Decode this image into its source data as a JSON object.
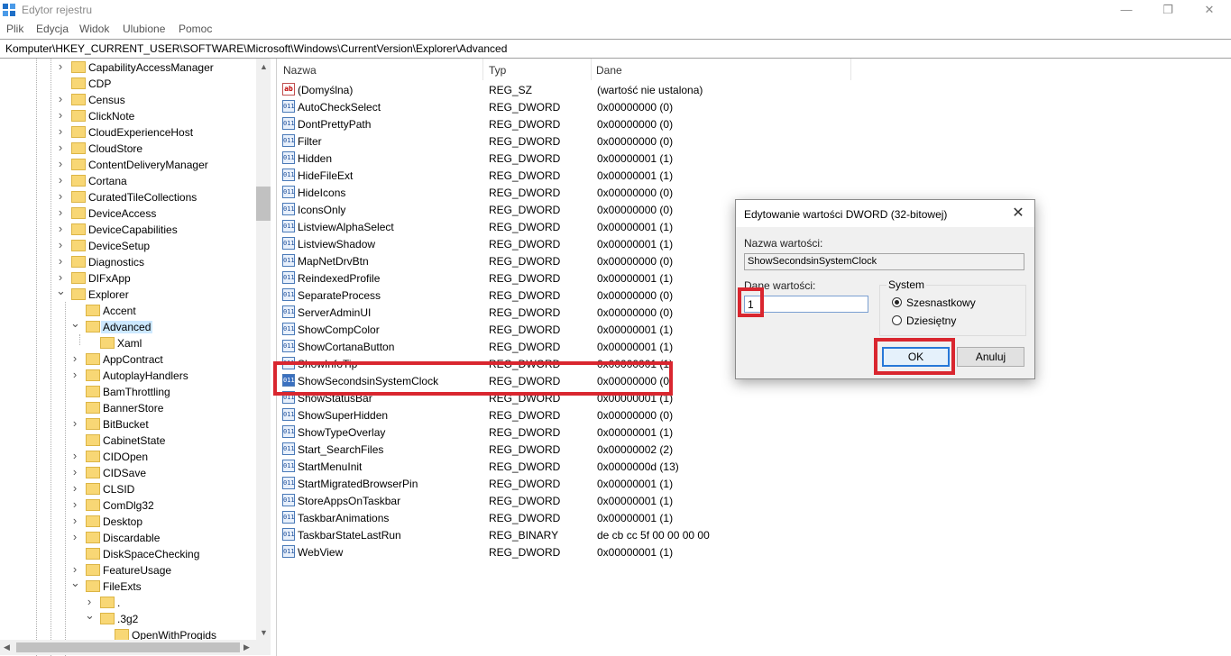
{
  "window": {
    "title": "Edytor rejestru",
    "minimize": "—",
    "restore": "❐",
    "close": "✕"
  },
  "menu": [
    "Plik",
    "Edycja",
    "Widok",
    "Ulubione",
    "Pomoc"
  ],
  "address": "Komputer\\HKEY_CURRENT_USER\\SOFTWARE\\Microsoft\\Windows\\CurrentVersion\\Explorer\\Advanced",
  "tree": [
    {
      "label": "CapabilityAccessManager",
      "level": 0,
      "expander": "collapsed"
    },
    {
      "label": "CDP",
      "level": 0,
      "expander": "none"
    },
    {
      "label": "Census",
      "level": 0,
      "expander": "collapsed"
    },
    {
      "label": "ClickNote",
      "level": 0,
      "expander": "collapsed"
    },
    {
      "label": "CloudExperienceHost",
      "level": 0,
      "expander": "collapsed"
    },
    {
      "label": "CloudStore",
      "level": 0,
      "expander": "collapsed"
    },
    {
      "label": "ContentDeliveryManager",
      "level": 0,
      "expander": "collapsed"
    },
    {
      "label": "Cortana",
      "level": 0,
      "expander": "collapsed"
    },
    {
      "label": "CuratedTileCollections",
      "level": 0,
      "expander": "collapsed"
    },
    {
      "label": "DeviceAccess",
      "level": 0,
      "expander": "collapsed"
    },
    {
      "label": "DeviceCapabilities",
      "level": 0,
      "expander": "collapsed"
    },
    {
      "label": "DeviceSetup",
      "level": 0,
      "expander": "collapsed"
    },
    {
      "label": "Diagnostics",
      "level": 0,
      "expander": "collapsed"
    },
    {
      "label": "DIFxApp",
      "level": 0,
      "expander": "collapsed"
    },
    {
      "label": "Explorer",
      "level": 0,
      "expander": "expanded"
    },
    {
      "label": "Accent",
      "level": 1,
      "expander": "none"
    },
    {
      "label": "Advanced",
      "level": 1,
      "expander": "expanded",
      "selected": true
    },
    {
      "label": "Xaml",
      "level": 2,
      "expander": "none"
    },
    {
      "label": "AppContract",
      "level": 1,
      "expander": "collapsed"
    },
    {
      "label": "AutoplayHandlers",
      "level": 1,
      "expander": "collapsed"
    },
    {
      "label": "BamThrottling",
      "level": 1,
      "expander": "none"
    },
    {
      "label": "BannerStore",
      "level": 1,
      "expander": "none"
    },
    {
      "label": "BitBucket",
      "level": 1,
      "expander": "collapsed"
    },
    {
      "label": "CabinetState",
      "level": 1,
      "expander": "none"
    },
    {
      "label": "CIDOpen",
      "level": 1,
      "expander": "collapsed"
    },
    {
      "label": "CIDSave",
      "level": 1,
      "expander": "collapsed"
    },
    {
      "label": "CLSID",
      "level": 1,
      "expander": "collapsed"
    },
    {
      "label": "ComDlg32",
      "level": 1,
      "expander": "collapsed"
    },
    {
      "label": "Desktop",
      "level": 1,
      "expander": "collapsed"
    },
    {
      "label": "Discardable",
      "level": 1,
      "expander": "collapsed"
    },
    {
      "label": "DiskSpaceChecking",
      "level": 1,
      "expander": "none"
    },
    {
      "label": "FeatureUsage",
      "level": 1,
      "expander": "collapsed"
    },
    {
      "label": "FileExts",
      "level": 1,
      "expander": "expanded"
    },
    {
      "label": ".",
      "level": 2,
      "expander": "collapsed"
    },
    {
      "label": ".3g2",
      "level": 2,
      "expander": "expanded"
    },
    {
      "label": "OpenWithProgids",
      "level": 3,
      "expander": "none"
    }
  ],
  "columns": [
    "Nazwa",
    "Typ",
    "Dane"
  ],
  "values": [
    {
      "name": "(Domyślna)",
      "type": "REG_SZ",
      "data": "(wartość nie ustalona)",
      "icon": "ab"
    },
    {
      "name": "AutoCheckSelect",
      "type": "REG_DWORD",
      "data": "0x00000000 (0)",
      "icon": "bin"
    },
    {
      "name": "DontPrettyPath",
      "type": "REG_DWORD",
      "data": "0x00000000 (0)",
      "icon": "bin"
    },
    {
      "name": "Filter",
      "type": "REG_DWORD",
      "data": "0x00000000 (0)",
      "icon": "bin"
    },
    {
      "name": "Hidden",
      "type": "REG_DWORD",
      "data": "0x00000001 (1)",
      "icon": "bin"
    },
    {
      "name": "HideFileExt",
      "type": "REG_DWORD",
      "data": "0x00000001 (1)",
      "icon": "bin"
    },
    {
      "name": "HideIcons",
      "type": "REG_DWORD",
      "data": "0x00000000 (0)",
      "icon": "bin"
    },
    {
      "name": "IconsOnly",
      "type": "REG_DWORD",
      "data": "0x00000000 (0)",
      "icon": "bin"
    },
    {
      "name": "ListviewAlphaSelect",
      "type": "REG_DWORD",
      "data": "0x00000001 (1)",
      "icon": "bin"
    },
    {
      "name": "ListviewShadow",
      "type": "REG_DWORD",
      "data": "0x00000001 (1)",
      "icon": "bin"
    },
    {
      "name": "MapNetDrvBtn",
      "type": "REG_DWORD",
      "data": "0x00000000 (0)",
      "icon": "bin"
    },
    {
      "name": "ReindexedProfile",
      "type": "REG_DWORD",
      "data": "0x00000001 (1)",
      "icon": "bin"
    },
    {
      "name": "SeparateProcess",
      "type": "REG_DWORD",
      "data": "0x00000000 (0)",
      "icon": "bin"
    },
    {
      "name": "ServerAdminUI",
      "type": "REG_DWORD",
      "data": "0x00000000 (0)",
      "icon": "bin"
    },
    {
      "name": "ShowCompColor",
      "type": "REG_DWORD",
      "data": "0x00000001 (1)",
      "icon": "bin"
    },
    {
      "name": "ShowCortanaButton",
      "type": "REG_DWORD",
      "data": "0x00000001 (1)",
      "icon": "bin"
    },
    {
      "name": "ShowInfoTip",
      "type": "REG_DWORD",
      "data": "0x00000001 (1)",
      "icon": "bin"
    },
    {
      "name": "ShowSecondsinSystemClock",
      "type": "REG_DWORD",
      "data": "0x00000000 (0)",
      "icon": "bin",
      "selected": true
    },
    {
      "name": "ShowStatusBar",
      "type": "REG_DWORD",
      "data": "0x00000001 (1)",
      "icon": "bin"
    },
    {
      "name": "ShowSuperHidden",
      "type": "REG_DWORD",
      "data": "0x00000000 (0)",
      "icon": "bin"
    },
    {
      "name": "ShowTypeOverlay",
      "type": "REG_DWORD",
      "data": "0x00000001 (1)",
      "icon": "bin"
    },
    {
      "name": "Start_SearchFiles",
      "type": "REG_DWORD",
      "data": "0x00000002 (2)",
      "icon": "bin"
    },
    {
      "name": "StartMenuInit",
      "type": "REG_DWORD",
      "data": "0x0000000d (13)",
      "icon": "bin"
    },
    {
      "name": "StartMigratedBrowserPin",
      "type": "REG_DWORD",
      "data": "0x00000001 (1)",
      "icon": "bin"
    },
    {
      "name": "StoreAppsOnTaskbar",
      "type": "REG_DWORD",
      "data": "0x00000001 (1)",
      "icon": "bin"
    },
    {
      "name": "TaskbarAnimations",
      "type": "REG_DWORD",
      "data": "0x00000001 (1)",
      "icon": "bin"
    },
    {
      "name": "TaskbarStateLastRun",
      "type": "REG_BINARY",
      "data": "de cb cc 5f 00 00 00 00",
      "icon": "bin"
    },
    {
      "name": "WebView",
      "type": "REG_DWORD",
      "data": "0x00000001 (1)",
      "icon": "bin"
    }
  ],
  "dialog": {
    "title": "Edytowanie wartości DWORD (32-bitowej)",
    "close": "✕",
    "name_label": "Nazwa wartości:",
    "name_value": "ShowSecondsinSystemClock",
    "data_label": "Dane wartości:",
    "data_value": "1",
    "base_label": "System",
    "base_options": [
      {
        "label": "Szesnastkowy",
        "selected": true
      },
      {
        "label": "Dziesiętny",
        "selected": false
      }
    ],
    "ok_label": "OK",
    "cancel_label": "Anuluj"
  },
  "colors": {
    "highlight": "#d9262f",
    "selection": "#cce8ff",
    "folder": "#f8d775"
  }
}
